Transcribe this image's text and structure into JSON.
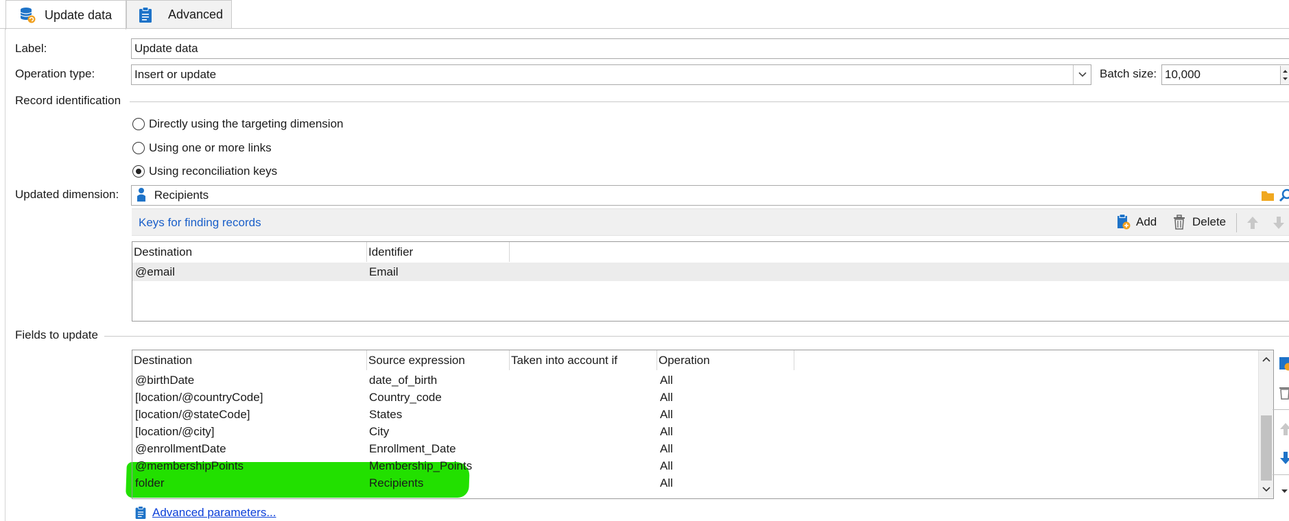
{
  "tabs": [
    {
      "label": "Update data",
      "icon": "database-update-icon",
      "active": true
    },
    {
      "label": "Advanced",
      "icon": "clipboard-icon",
      "active": false
    }
  ],
  "form": {
    "label_caption": "Label:",
    "label_value": "Update data",
    "operation_caption": "Operation type:",
    "operation_value": "Insert or update",
    "batch_caption": "Batch size:",
    "batch_value": "10,000",
    "record_id_title": "Record identification",
    "radios": [
      {
        "label": "Directly using the targeting dimension",
        "checked": false
      },
      {
        "label": "Using one or more links",
        "checked": false
      },
      {
        "label": "Using reconciliation keys",
        "checked": true
      }
    ],
    "dimension_caption": "Updated dimension:",
    "dimension_value": "Recipients"
  },
  "keys_toolbar": {
    "title": "Keys for finding records",
    "add_label": "Add",
    "delete_label": "Delete"
  },
  "keys_table": {
    "headers": [
      "Destination",
      "Identifier"
    ],
    "rows": [
      {
        "destination": "@email",
        "identifier": "Email"
      }
    ]
  },
  "fields_title": "Fields to update",
  "fields_table": {
    "headers": [
      "Destination",
      "Source expression",
      "Taken into account if",
      "Operation"
    ],
    "rows": [
      {
        "destination": "@birthDate",
        "source": "date_of_birth",
        "condition": "",
        "operation": "All"
      },
      {
        "destination": "[location/@countryCode]",
        "source": "Country_code",
        "condition": "",
        "operation": "All"
      },
      {
        "destination": "[location/@stateCode]",
        "source": "States",
        "condition": "",
        "operation": "All"
      },
      {
        "destination": "[location/@city]",
        "source": "City",
        "condition": "",
        "operation": "All"
      },
      {
        "destination": "@enrollmentDate",
        "source": "Enrollment_Date",
        "condition": "",
        "operation": "All"
      },
      {
        "destination": "@membershipPoints",
        "source": "Membership_Points",
        "condition": "",
        "operation": "All"
      },
      {
        "destination": "folder",
        "source": "Recipients",
        "condition": "",
        "operation": "All"
      }
    ]
  },
  "advanced_link": "Advanced parameters...",
  "colors": {
    "highlight": "#22e000",
    "link": "#1a5fc9",
    "icon_blue": "#1e73c8",
    "icon_orange": "#f0a020"
  }
}
